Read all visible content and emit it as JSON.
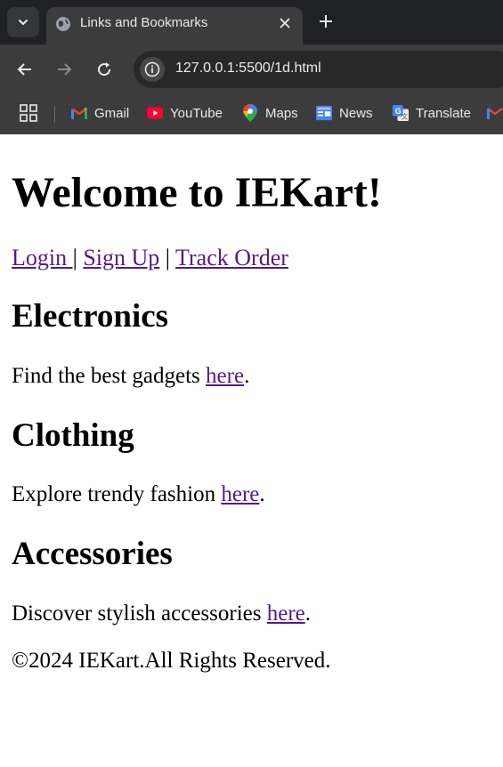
{
  "browser": {
    "tab_title": "Links and Bookmarks",
    "url": "127.0.0.1:5500/1d.html",
    "bookmarks": [
      {
        "label": "Gmail",
        "icon": "gmail-icon"
      },
      {
        "label": "YouTube",
        "icon": "youtube-icon"
      },
      {
        "label": "Maps",
        "icon": "maps-icon"
      },
      {
        "label": "News",
        "icon": "news-icon"
      },
      {
        "label": "Translate",
        "icon": "translate-icon"
      }
    ]
  },
  "page": {
    "heading": "Welcome to IEKart!",
    "nav": {
      "login": "Login ",
      "sep1": "| ",
      "signup": "Sign Up",
      "sep2": " | ",
      "track": "Track Order"
    },
    "sections": [
      {
        "title": "Electronics",
        "text": "Find the best gadgets ",
        "link": "here",
        "end": "."
      },
      {
        "title": "Clothing",
        "text": "Explore trendy fashion ",
        "link": "here",
        "end": "."
      },
      {
        "title": "Accessories",
        "text": "Discover stylish accessories ",
        "link": "here",
        "end": "."
      }
    ],
    "footer": "©2024 IEKart.All Rights Reserved."
  },
  "colors": {
    "link_visited": "#551a8b",
    "chrome_bg": "#3c3c3c",
    "tabstrip_bg": "#202124"
  }
}
